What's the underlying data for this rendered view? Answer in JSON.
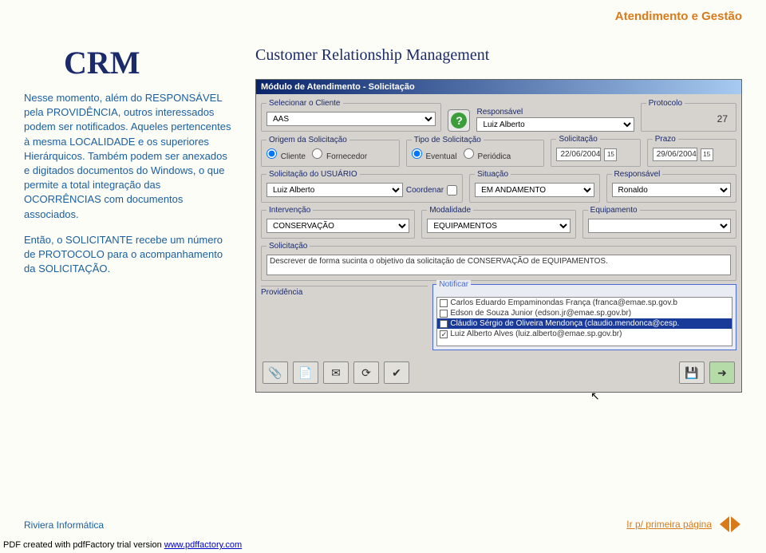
{
  "header": {
    "title": "Atendimento e Gestão"
  },
  "left": {
    "logo": "CRM",
    "para1": "Nesse momento, além do RESPONSÁVEL pela PROVIDÊNCIA, outros interessados podem ser notificados. Aqueles pertencentes à mesma LOCALIDADE e os superiores Hierárquicos. Também podem ser anexados e digitados documentos do Windows, o que permite a total integração das OCORRÊNCIAS com documentos associados.",
    "para2": "Então, o SOLICITANTE recebe um número de PROTOCOLO para o acompanhamento da SOLICITAÇÃO."
  },
  "right": {
    "subtitle": "Customer Relationship Management"
  },
  "dialog": {
    "title": "Módulo de Atendimento - Solicitação",
    "section_client": "Selecionar o Cliente",
    "client_value": "AAS",
    "label_responsavel": "Responsável",
    "responsavel_value": "Luiz Alberto",
    "label_protocolo": "Protocolo",
    "protocolo_value": "27",
    "label_origem": "Origem da Solicitação",
    "origem_opt1": "Cliente",
    "origem_opt2": "Fornecedor",
    "label_tipo": "Tipo de Solicitação",
    "tipo_opt1": "Eventual",
    "tipo_opt2": "Periódica",
    "label_solicitacao_date": "Solicitação",
    "solicitacao_date": "22/06/2004",
    "label_prazo": "Prazo",
    "prazo_date": "29/06/2004",
    "label_su": "Solicitação do USUÁRIO",
    "su_value": "Luiz Alberto",
    "coord_label": "Coordenar",
    "label_situacao": "Situação",
    "situacao_value": "EM ANDAMENTO",
    "label_resp2": "Responsável",
    "resp2_value": "Ronaldo",
    "label_interv": "Intervenção",
    "interv_value": "CONSERVAÇÃO",
    "label_modal": "Modalidade",
    "modal_value": "EQUIPAMENTOS",
    "label_equip": "Equipamento",
    "equip_value": "",
    "label_desc": "Solicitação",
    "desc_value": "Descrever de forma sucinta o objetivo da solicitação de CONSERVAÇÃO de EQUIPAMENTOS.",
    "notify_label": "Notificar",
    "notify_items": [
      {
        "checked": false,
        "text": "Carlos Eduardo Empaminondas França (franca@emae.sp.gov.b"
      },
      {
        "checked": false,
        "text": "Edson de Souza Junior (edson.jr@emae.sp.gov.br)"
      },
      {
        "checked": true,
        "text": "Cláudio Sérgio de Oliveira Mendonça (claudio.mendonca@cesp."
      },
      {
        "checked": true,
        "text": "Luiz Alberto Alves (luiz.alberto@emae.sp.gov.br)"
      }
    ],
    "providencia_label": "Providência"
  },
  "footer": {
    "left": "Riviera Informática",
    "link": "Ir p/ primeira página"
  },
  "pdfline": {
    "prefix": "PDF created with pdfFactory trial version ",
    "link": "www.pdffactory.com"
  }
}
